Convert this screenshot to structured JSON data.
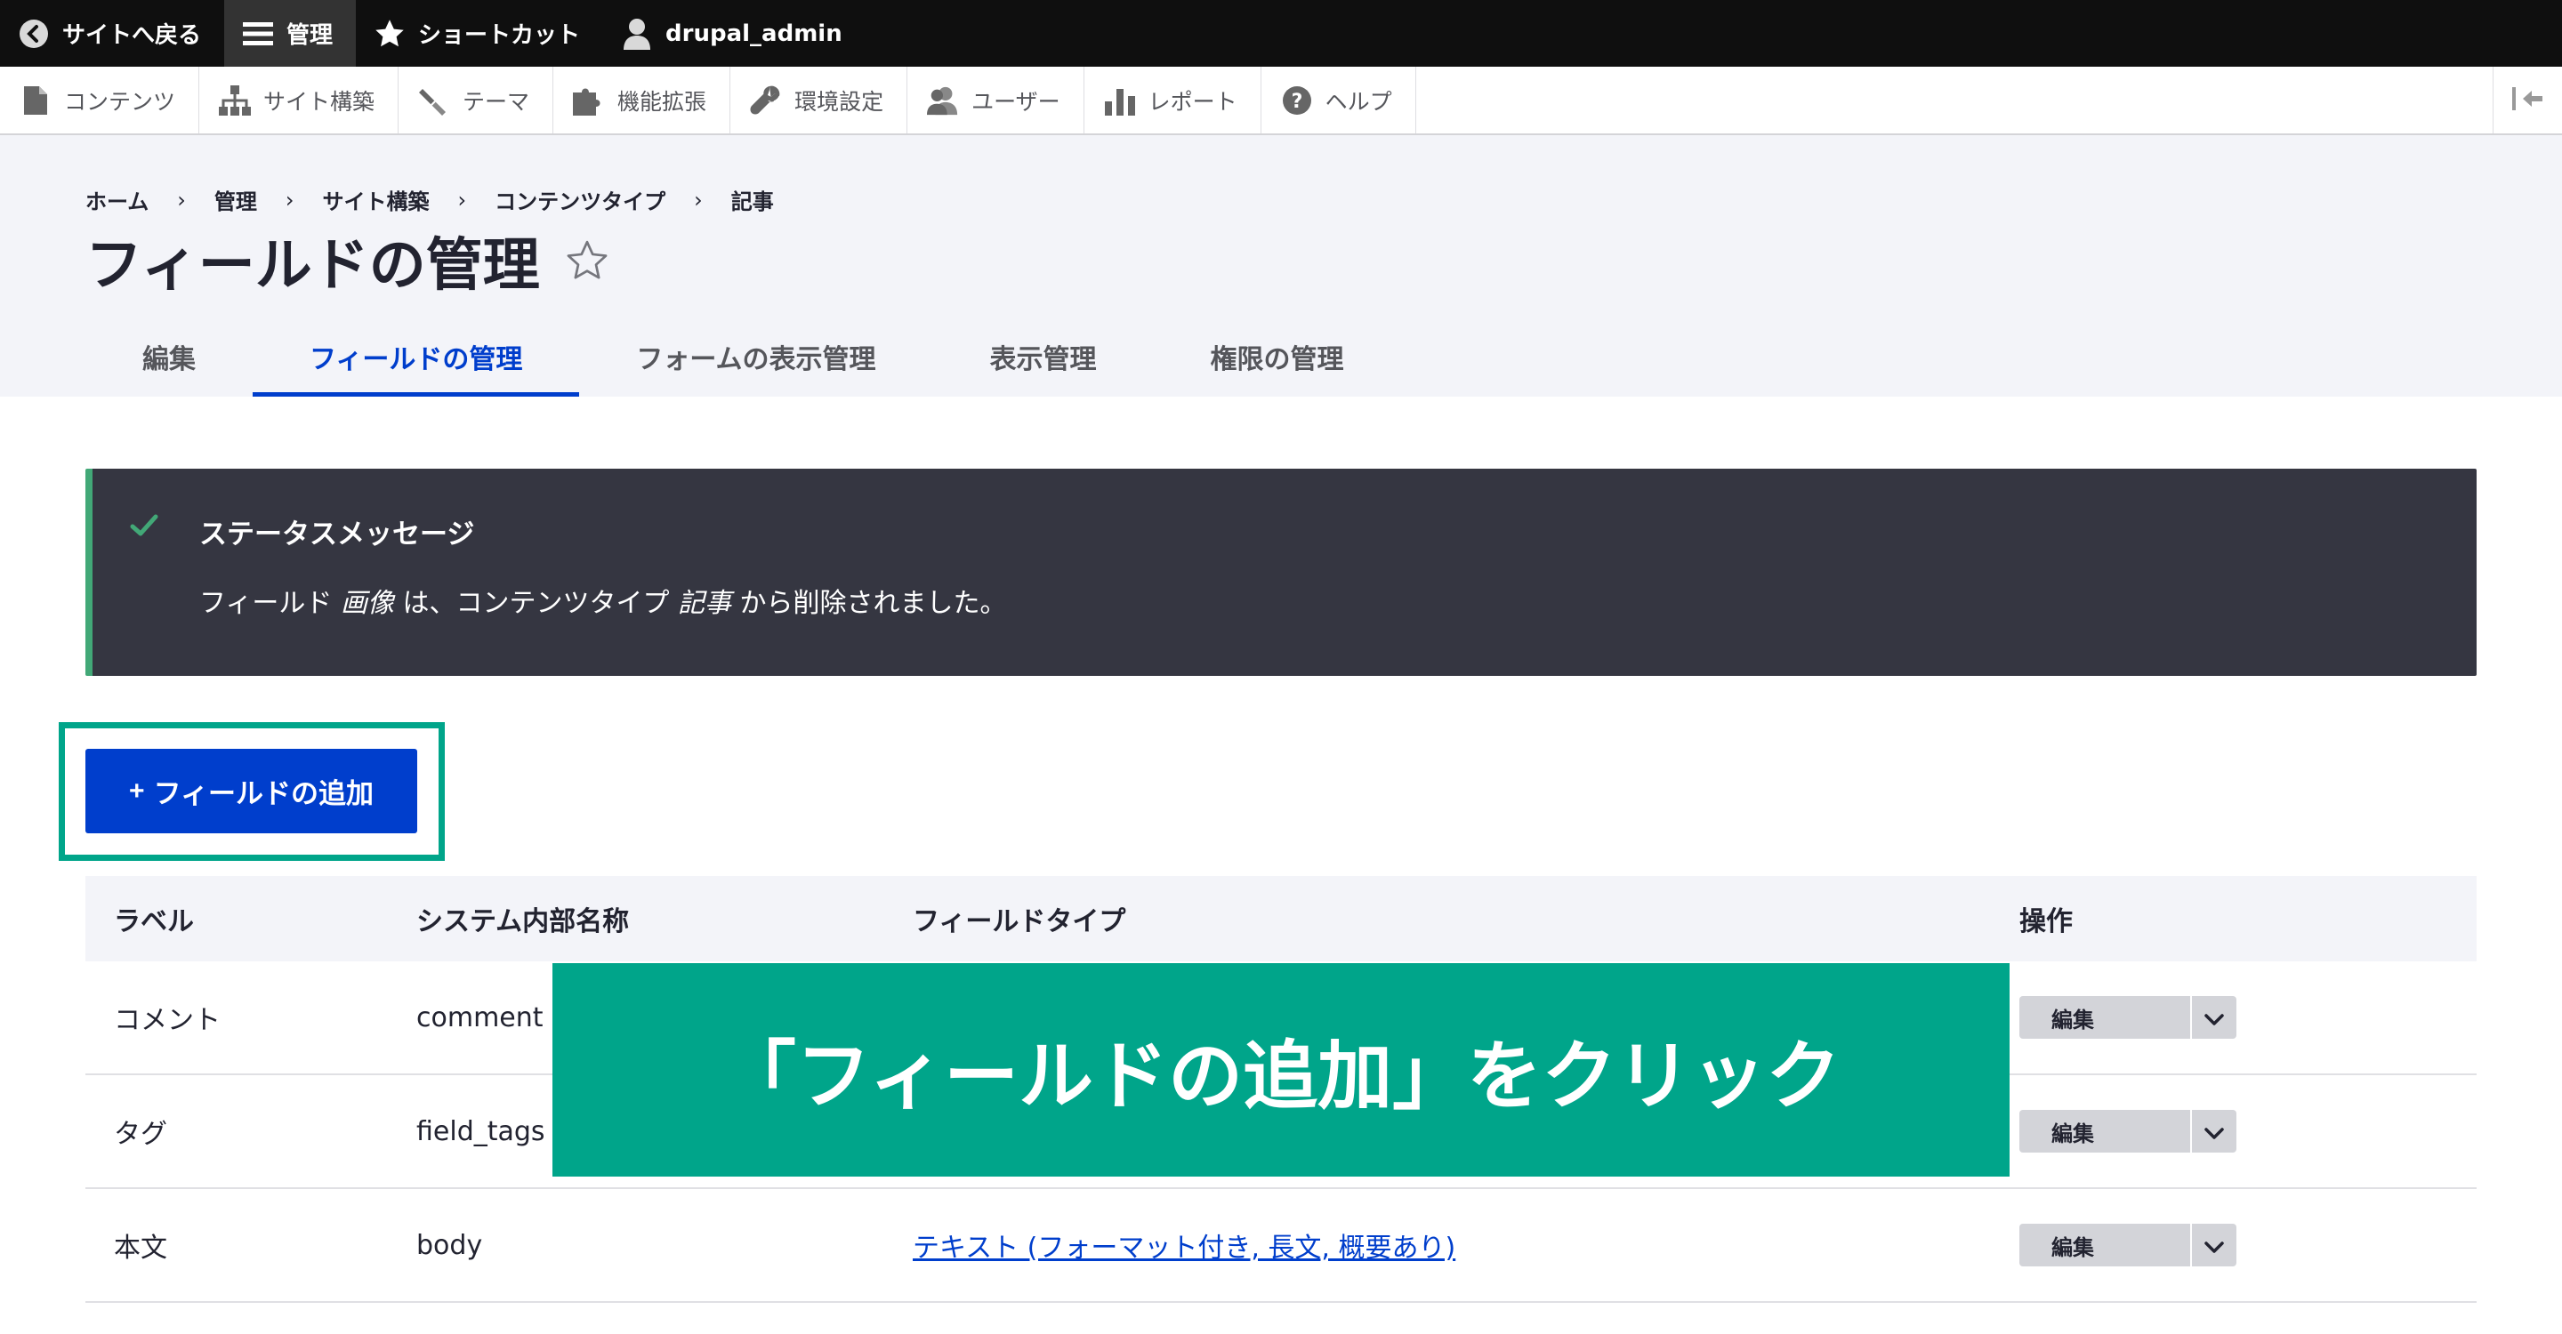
{
  "toolbar": {
    "back_to_site": "サイトへ戻る",
    "manage": "管理",
    "shortcuts": "ショートカット",
    "user": "drupal_admin"
  },
  "tray": {
    "items": [
      {
        "label": "コンテンツ",
        "icon": "file-icon"
      },
      {
        "label": "サイト構築",
        "icon": "sitemap-icon"
      },
      {
        "label": "テーマ",
        "icon": "paintbrush-icon"
      },
      {
        "label": "機能拡張",
        "icon": "puzzle-icon"
      },
      {
        "label": "環境設定",
        "icon": "wrench-icon"
      },
      {
        "label": "ユーザー",
        "icon": "people-icon"
      },
      {
        "label": "レポート",
        "icon": "bar-chart-icon"
      },
      {
        "label": "ヘルプ",
        "icon": "help-icon"
      }
    ]
  },
  "breadcrumb": [
    "ホーム",
    "管理",
    "サイト構築",
    "コンテンツタイプ",
    "記事"
  ],
  "page": {
    "title": "フィールドの管理"
  },
  "tabs": [
    {
      "label": "編集",
      "active": false
    },
    {
      "label": "フィールドの管理",
      "active": true
    },
    {
      "label": "フォームの表示管理",
      "active": false
    },
    {
      "label": "表示管理",
      "active": false
    },
    {
      "label": "権限の管理",
      "active": false
    }
  ],
  "status": {
    "title": "ステータスメッセージ",
    "text_before": "フィールド ",
    "field_name": "画像",
    "text_middle": " は、コンテンツタイプ ",
    "content_type": "記事",
    "text_after": " から削除されました。"
  },
  "add_field": {
    "plus": "+",
    "label": "フィールドの追加"
  },
  "table": {
    "headers": [
      "ラベル",
      "システム内部名称",
      "フィールドタイプ",
      "操作"
    ],
    "rows": [
      {
        "label": "コメント",
        "machine_name": "comment",
        "type": "",
        "op": "編集"
      },
      {
        "label": "タグ",
        "machine_name": "field_tags",
        "type": "",
        "op": "編集"
      },
      {
        "label": "本文",
        "machine_name": "body",
        "type": "テキスト (フォーマット付き, 長文, 概要あり)",
        "op": "編集"
      }
    ]
  },
  "overlay": {
    "text": "「フィールドの追加」をクリック"
  },
  "colors": {
    "accent": "#003ecc",
    "highlight": "#00a58a",
    "status_bg": "#353641",
    "status_border": "#42a877"
  }
}
